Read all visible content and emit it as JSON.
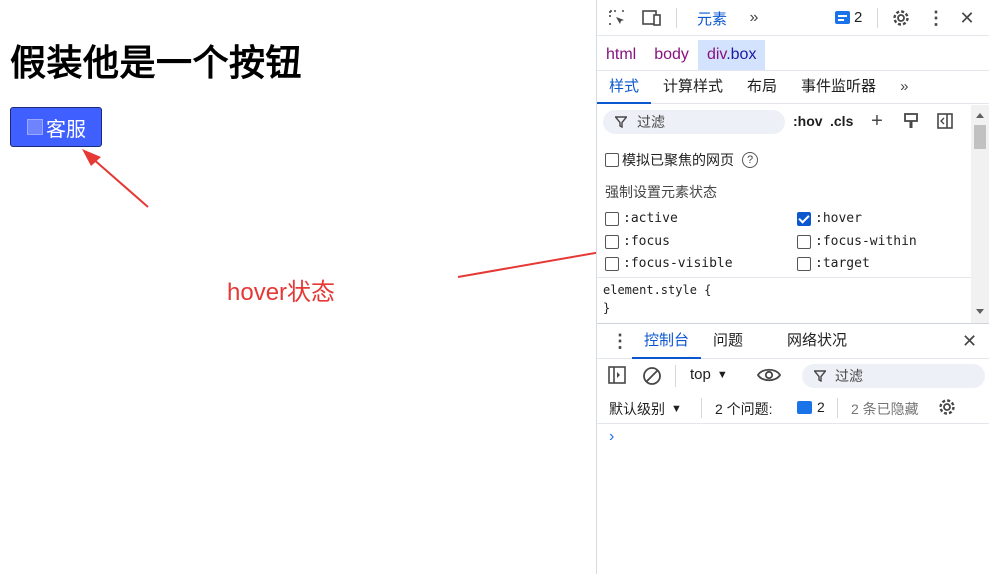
{
  "page": {
    "title": "假装他是一个按钮",
    "button_label": "客服",
    "annotation": "hover状态",
    "colors": {
      "button": "#3f5fff",
      "annotation": "#e53935"
    }
  },
  "devtools": {
    "toolbar": {
      "elements_tab": "元素",
      "issue_count": "2"
    },
    "breadcrumbs": {
      "html": "html",
      "body": "body",
      "div_tag": "div",
      "div_class": ".box"
    },
    "subtabs": [
      "样式",
      "计算样式",
      "布局",
      "事件监听器"
    ],
    "filter": {
      "placeholder": "过滤",
      "hov": ":hov",
      "cls": ".cls"
    },
    "emulate_focus_label": "模拟已聚焦的网页",
    "force_state_label": "强制设置元素状态",
    "states": [
      {
        "label": ":active",
        "checked": false
      },
      {
        "label": ":hover",
        "checked": true
      },
      {
        "label": ":focus",
        "checked": false
      },
      {
        "label": ":focus-within",
        "checked": false
      },
      {
        "label": ":focus-visible",
        "checked": false
      },
      {
        "label": ":target",
        "checked": false
      }
    ],
    "element_style": {
      "open": "element.style {",
      "close": "}"
    },
    "drawer": {
      "tabs": [
        "控制台",
        "问题",
        "网络状况"
      ],
      "context": "top",
      "filter_placeholder": "过滤",
      "level": "默认级别",
      "issues_label": "2 个问题:",
      "issues_count": "2",
      "hidden": "2 条已隐藏",
      "prompt": "›"
    },
    "colors": {
      "accent": "#0b57d0",
      "selected_crumb": "#d3e3fd"
    }
  }
}
